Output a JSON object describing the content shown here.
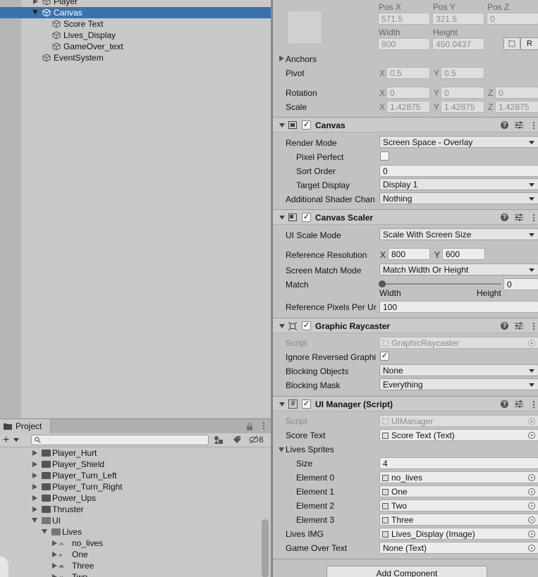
{
  "hierarchy": {
    "items": [
      {
        "label": "Player"
      },
      {
        "label": "Canvas"
      },
      {
        "label": "Score Text"
      },
      {
        "label": "Lives_Display"
      },
      {
        "label": "GameOver_text"
      },
      {
        "label": "EventSystem"
      }
    ]
  },
  "project": {
    "tab_label": "Project",
    "add_label": "+",
    "hidden_count": "8",
    "folders": [
      {
        "label": "Player_Hurt"
      },
      {
        "label": "Player_Shield"
      },
      {
        "label": "Player_Turn_Left"
      },
      {
        "label": "Player_Turn_Right"
      },
      {
        "label": "Power_Ups"
      },
      {
        "label": "Thruster"
      },
      {
        "label": "UI"
      },
      {
        "label": "Lives"
      }
    ],
    "sprites": [
      {
        "label": "no_lives"
      },
      {
        "label": "One"
      },
      {
        "label": "Three"
      },
      {
        "label": "Two"
      }
    ]
  },
  "inspector": {
    "rect": {
      "posx_label": "Pos X",
      "posy_label": "Pos Y",
      "posz_label": "Pos Z",
      "posx": "571.5",
      "posy": "321.5",
      "posz": "0",
      "width_label": "Width",
      "height_label": "Height",
      "width": "800",
      "height": "450.0437",
      "raw_button": "R",
      "anchors_label": "Anchors",
      "pivot_label": "Pivot",
      "pivot_x": "0.5",
      "pivot_y": "0.5",
      "rotation_label": "Rotation",
      "rot_x": "0",
      "rot_y": "0",
      "rot_z": "0",
      "scale_label": "Scale",
      "scale_x": "1.42875",
      "scale_y": "1.42875",
      "scale_z": "1.42875",
      "axis_x": "X",
      "axis_y": "Y",
      "axis_z": "Z"
    },
    "canvas": {
      "title": "Canvas",
      "render_mode_label": "Render Mode",
      "render_mode": "Screen Space - Overlay",
      "pixel_perfect_label": "Pixel Perfect",
      "sort_order_label": "Sort Order",
      "sort_order": "0",
      "target_display_label": "Target Display",
      "target_display": "Display 1",
      "shader_label": "Additional Shader Chan",
      "shader": "Nothing"
    },
    "scaler": {
      "title": "Canvas Scaler",
      "ui_scale_label": "UI Scale Mode",
      "ui_scale": "Scale With Screen Size",
      "ref_res_label": "Reference Resolution",
      "ref_x": "800",
      "ref_y": "600",
      "match_mode_label": "Screen Match Mode",
      "match_mode": "Match Width Or Height",
      "match_label": "Match",
      "match_value": "0",
      "match_slider": 0,
      "width_caption": "Width",
      "height_caption": "Height",
      "ppu_label": "Reference Pixels Per Ur",
      "ppu": "100"
    },
    "raycaster": {
      "title": "Graphic Raycaster",
      "script_label": "Script",
      "script": "GraphicRaycaster",
      "ignore_label": "Ignore Reversed Graphi",
      "ignore_check": "✓",
      "blocking_obj_label": "Blocking Objects",
      "blocking_obj": "None",
      "blocking_mask_label": "Blocking Mask",
      "blocking_mask": "Everything"
    },
    "uimanager": {
      "title": "UI Manager (Script)",
      "script_label": "Script",
      "script": "UIManager",
      "score_label": "Score Text",
      "score": "Score Text (Text)",
      "lives_sprites_label": "Lives Sprites",
      "size_label": "Size",
      "size": "4",
      "elements": [
        {
          "label": "Element 0",
          "value": "no_lives"
        },
        {
          "label": "Element 1",
          "value": "One"
        },
        {
          "label": "Element 2",
          "value": "Two"
        },
        {
          "label": "Element 3",
          "value": "Three"
        }
      ],
      "lives_img_label": "Lives IMG",
      "lives_img": "Lives_Display (Image)",
      "gameover_label": "Game Over Text",
      "gameover": "None (Text)"
    },
    "add_component": "Add Component",
    "check": "✓"
  }
}
